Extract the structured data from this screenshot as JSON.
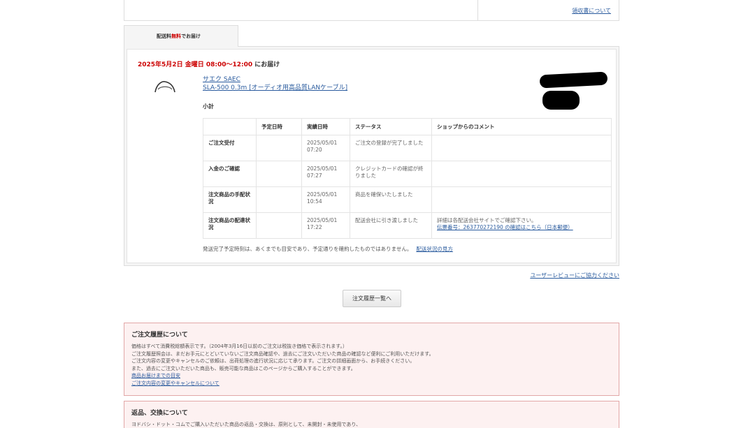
{
  "top": {
    "receipt_link": "領収書について"
  },
  "tab": {
    "prefix": "配送料",
    "free": "無料",
    "suffix": "でお届け"
  },
  "delivery": {
    "date": "2025年5月2日 金曜日 08:00～12:00",
    "suffix": " にお届け"
  },
  "product": {
    "brand": "サエク SAEC",
    "name": "SLA-500 0.3m [オーディオ用高品質LANケーブル]",
    "subtotal_label": "小計"
  },
  "status_table": {
    "headers": [
      "",
      "予定日時",
      "実績日時",
      "ステータス",
      "ショップからのコメント"
    ],
    "rows": [
      {
        "label": "ご注文受付",
        "planned": "",
        "actual": "2025/05/01 07:20",
        "status": "ご注文の登録が完了しました",
        "comment": "",
        "comment_link": ""
      },
      {
        "label": "入金のご確認",
        "planned": "",
        "actual": "2025/05/01 07:27",
        "status": "クレジットカードの確認が終りました",
        "comment": "",
        "comment_link": ""
      },
      {
        "label": "注文商品の手配状況",
        "planned": "",
        "actual": "2025/05/01 10:54",
        "status": "商品を確保いたしました",
        "comment": "",
        "comment_link": ""
      },
      {
        "label": "注文商品の配達状況",
        "planned": "",
        "actual": "2025/05/01 17:22",
        "status": "配送会社に引き渡しました",
        "comment": "詳細は各配送会社サイトでご確認下さい。",
        "comment_link": "伝票番号：263770272190 の確認はこちら（日本郵便）"
      }
    ]
  },
  "note": {
    "text": "発送完了予定時刻は、あくまでも目安であり、予定通りを確約したものではありません。",
    "link": "配送状況の見方"
  },
  "review_link": "ユーザーレビューにご協力ください",
  "history_button": "注文履歴一覧へ",
  "info_box": {
    "title": "ご注文履歴について",
    "lines": [
      "価格はすべて消費税総額表示です。（2004年3月16日以前のご注文は税抜き価格で表示されます。）",
      "ご注文履歴照会は、まだお手元にとどいていないご注文商品確認や、過去にご注文いただいた商品の確認など便利にご利用いただけます。",
      "ご注文内容の変更やキャンセルのご依頼は、出荷処理の進行状況に応じて承ります。ご注文の詳細画面から、お手続きください。",
      "また、過去にご注文いただいた商品も、販売可能な商品はこのページからご購入することができます。"
    ],
    "links": [
      "商品お届けまでの目安",
      "ご注文内容の変更やキャンセルについて"
    ]
  },
  "returns_box": {
    "title": "返品、交換について",
    "line": "ヨドバシ・ドット・コムでご購入いただいた商品の返品・交換は、原則として、未開封・未使用であり、"
  }
}
